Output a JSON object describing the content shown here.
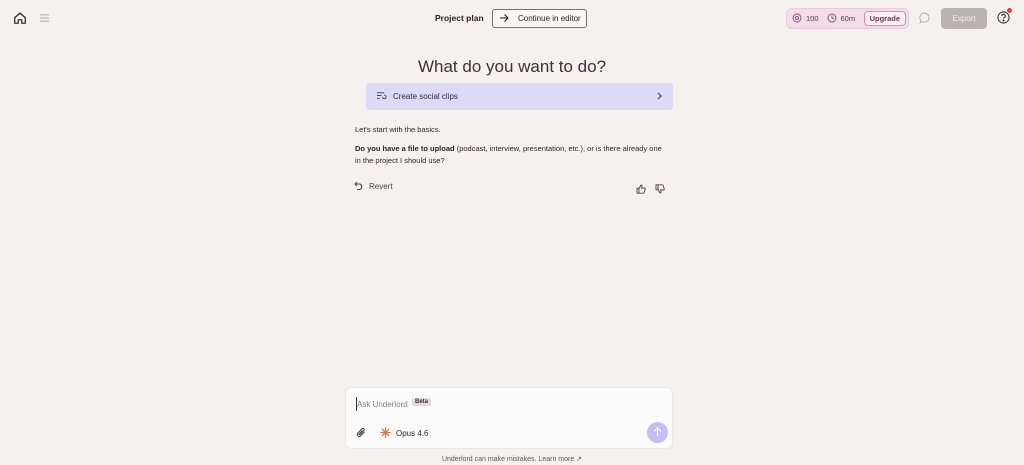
{
  "header": {
    "project_title": "Project plan",
    "continue_label": "Continue in editor",
    "credits": {
      "ai_credits": "100",
      "minutes": "60m"
    },
    "upgrade_label": "Upgrade",
    "export_label": "Export"
  },
  "main": {
    "heading": "What do you want to do?",
    "suggestion_label": "Create social clips",
    "message_intro": "Let's start with the basics.",
    "message_bold": "Do you have a file to upload",
    "message_rest": " (podcast, interview, presentation, etc.), or is there already one in the project I should use?",
    "revert_label": "Revert"
  },
  "composer": {
    "placeholder": "Ask Underlord",
    "badge": "Beta",
    "model_label": "Opus 4.6"
  },
  "footer": {
    "disclaimer": "Underlord can make mistakes.",
    "learn_more": "Learn more ↗"
  },
  "colors": {
    "background": "#f5f1ef",
    "suggestion_bg": "#dcdaf7",
    "credits_bg": "#f5dcea",
    "send_button": "#c3bff0",
    "notification": "#e0443a"
  },
  "icons": [
    "home-icon",
    "menu-icon",
    "arrow-right-icon",
    "credit-icon",
    "clock-icon",
    "comment-icon",
    "help-icon",
    "clips-icon",
    "chevron-right-icon",
    "undo-icon",
    "thumbs-up-icon",
    "thumbs-down-icon",
    "paperclip-icon",
    "sparkle-icon",
    "arrow-up-icon"
  ]
}
